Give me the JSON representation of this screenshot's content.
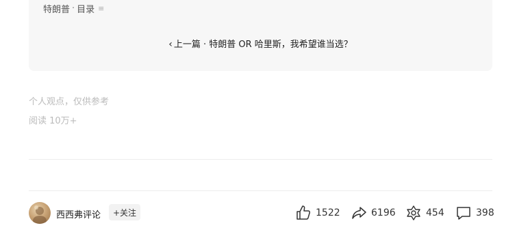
{
  "catalog": {
    "series_name": "特朗普",
    "separator": "·",
    "label": "目录",
    "icon": "menu-icon"
  },
  "prev_article": {
    "label": "上一篇",
    "separator": "·",
    "title": "特朗普 OR 哈里斯，我希望谁当选？",
    "icon": "chevron-left-icon"
  },
  "note": "个人观点，仅供参考",
  "reads": "阅读 10万+",
  "footer": {
    "author": "西西弗评论",
    "follow_label": "+关注",
    "like_count": "1522",
    "share_count": "6196",
    "recommend_count": "454",
    "comment_count": "398",
    "icons": [
      "thumbs-up-icon",
      "share-icon",
      "recommend-icon",
      "comment-icon"
    ]
  }
}
